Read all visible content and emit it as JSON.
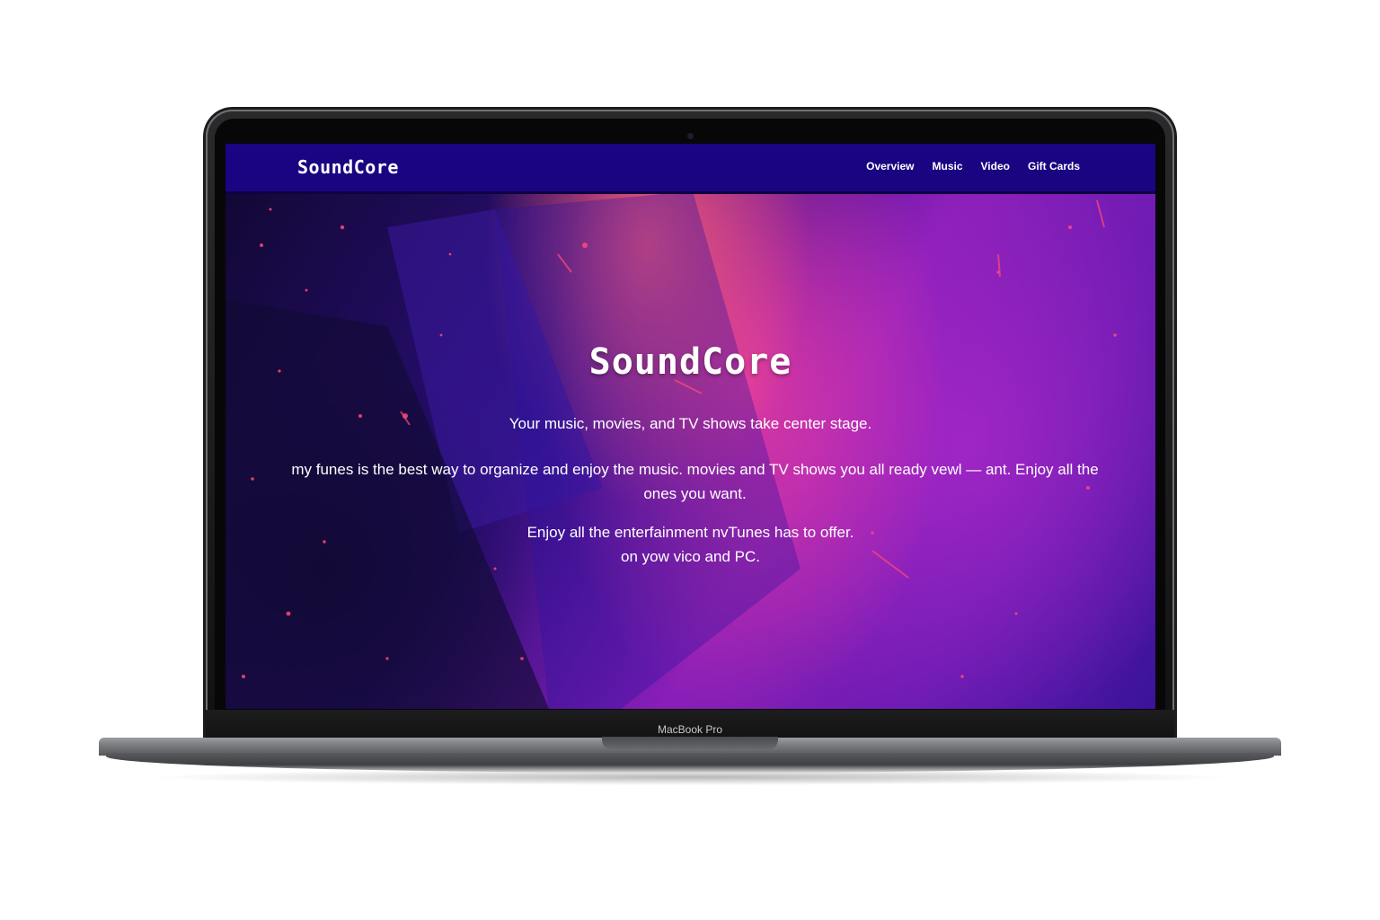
{
  "device": {
    "model_label": "MacBook Pro"
  },
  "navbar": {
    "brand": "SoundCore",
    "links": [
      {
        "label": "Overview"
      },
      {
        "label": "Music"
      },
      {
        "label": "Video"
      },
      {
        "label": "Gift Cards"
      }
    ]
  },
  "hero": {
    "title": "SoundCore",
    "subtitle": "Your music, movies, and TV shows take center stage.",
    "description": "my funes is the best way to organize and enjoy the music. movies  and TV shows you all ready vewl — ant. Enjoy all the ones you want.",
    "extra_line1": "Enjoy all the enterfainment nvTunes has to offer.",
    "extra_line2": "on yow vico and PC."
  },
  "colors": {
    "navbar": "#1a0482",
    "hero_pink": "#ff5c78",
    "hero_purple": "#8a1fb8",
    "hero_dark": "#120835"
  }
}
